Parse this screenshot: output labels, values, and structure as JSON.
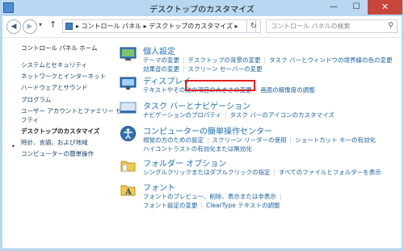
{
  "window": {
    "title": "デスクトップのカスタマイズ",
    "controls": {
      "minimize": "—",
      "maximize": "☐",
      "close": "✕"
    }
  },
  "address_bar": {
    "back_icon": "back-arrow-icon",
    "forward_icon": "forward-arrow-icon",
    "crumbs": "▸  コントロール パネル  ▸  デスクトップのカスタマイズ  ▸",
    "refresh_glyph": "↻",
    "search_placeholder": "コントロール パネルの検索"
  },
  "left_nav": {
    "home": "コントロール パネル ホーム",
    "items": [
      {
        "label": "システムとセキュリティ",
        "current": false
      },
      {
        "label": "ネットワークとインターネット",
        "current": false
      },
      {
        "label": "ハードウェアとサウンド",
        "current": false
      },
      {
        "label": "プログラム",
        "current": false
      },
      {
        "label": "ユーザー アカウントとファミリー セー",
        "current": false
      },
      {
        "label": "フティ",
        "current": false
      },
      {
        "label": "デスクトップのカスタマイズ",
        "current": true
      },
      {
        "label": "時計、言語、および地域",
        "current": false
      },
      {
        "label": "コンピューターの簡単操作",
        "current": false
      }
    ]
  },
  "categories": [
    {
      "title": "個人設定",
      "icon": "personalization-icon",
      "links": [
        "テーマの変更",
        "デスクトップの背景の変更",
        "タスク バーとウィンドウの境界線の色の変更",
        "効果音の変更",
        "スクリーン セーバーの変更"
      ]
    },
    {
      "title": "ディスプレイ",
      "icon": "display-icon",
      "links": [
        "テキストやその他の項目の大きさの変更",
        "画面の解像度の調整"
      ]
    },
    {
      "title": "タスク バーとナビゲーション",
      "icon": "taskbar-icon",
      "links": [
        "ナビゲーションのプロパティ",
        "タスク バーのアイコンのカスタマイズ"
      ]
    },
    {
      "title": "コンピューターの簡単操作センター",
      "icon": "ease-of-access-icon",
      "links": [
        "視覚の方のための設定",
        "スクリーン リーダーの使用",
        "ショートカット キーの有効化",
        "ハイコントラストの有効化または無効化"
      ]
    },
    {
      "title": "フォルダー オプション",
      "icon": "folder-options-icon",
      "links": [
        "シングルクリックまたはダブルクリックの指定",
        "すべてのファイルとフォルダーを表示"
      ]
    },
    {
      "title": "フォント",
      "icon": "fonts-icon",
      "links": [
        "フォントのプレビュー、削除、表示または非表示",
        "フォント設定の変更",
        "ClearType テキストの調整"
      ]
    }
  ],
  "colors": {
    "frame": "#b9d7f0",
    "link": "#1b5fa0",
    "title": "#1d6fb8",
    "highlight": "#e02020",
    "close_button": "#c7453a"
  }
}
